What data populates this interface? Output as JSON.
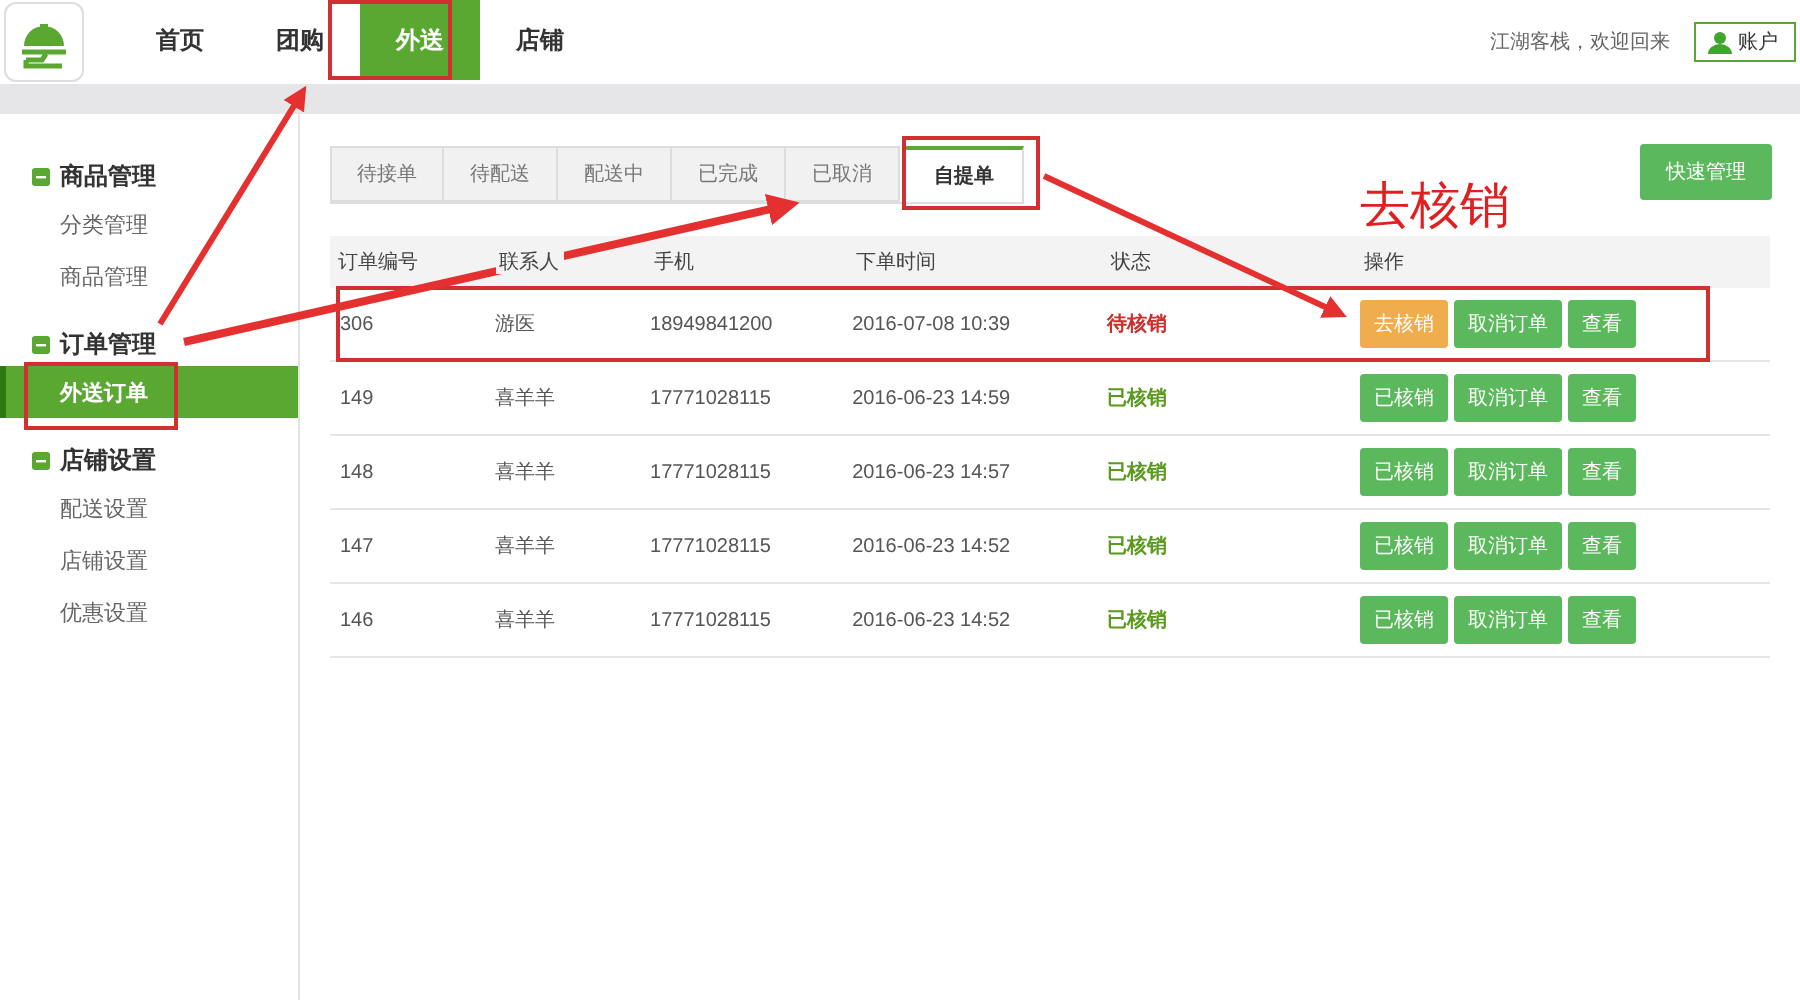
{
  "top_nav": [
    {
      "label": "首页",
      "selected": false
    },
    {
      "label": "团购",
      "selected": false
    },
    {
      "label": "外送",
      "selected": true
    },
    {
      "label": "店铺",
      "selected": false
    }
  ],
  "user": {
    "greeting": "江湖客栈，欢迎回来",
    "account": "账户"
  },
  "sidebar": [
    {
      "title": "商品管理",
      "expanded": true,
      "items": [
        {
          "label": "分类管理",
          "selected": false
        },
        {
          "label": "商品管理",
          "selected": false
        }
      ]
    },
    {
      "title": "订单管理",
      "expanded": true,
      "items": [
        {
          "label": "外送订单",
          "selected": true
        }
      ]
    },
    {
      "title": "店铺设置",
      "expanded": true,
      "items": [
        {
          "label": "配送设置",
          "selected": false
        },
        {
          "label": "店铺设置",
          "selected": false
        },
        {
          "label": "优惠设置",
          "selected": false
        }
      ]
    }
  ],
  "tabs": [
    {
      "label": "待接单",
      "selected": false
    },
    {
      "label": "待配送",
      "selected": false
    },
    {
      "label": "配送中",
      "selected": false
    },
    {
      "label": "已完成",
      "selected": false
    },
    {
      "label": "已取消",
      "selected": false
    },
    {
      "label": "自提单",
      "selected": true
    }
  ],
  "quick_button": "快速管理",
  "annotation": "去核销",
  "table": {
    "columns": [
      "订单编号",
      "联系人",
      "手机",
      "下单时间",
      "状态",
      "操作"
    ],
    "rows": [
      {
        "id": "306",
        "contact": "游医",
        "phone": "18949841200",
        "time": "2016-07-08 10:39",
        "status": {
          "text": "待核销",
          "kind": "pending"
        },
        "actions": [
          {
            "label": "去核销",
            "kind": "warn"
          },
          {
            "label": "取消订单",
            "kind": "ok"
          },
          {
            "label": "查看",
            "kind": "ok"
          }
        ]
      },
      {
        "id": "149",
        "contact": "喜羊羊",
        "phone": "17771028115",
        "time": "2016-06-23 14:59",
        "status": {
          "text": "已核销",
          "kind": "done"
        },
        "actions": [
          {
            "label": "已核销",
            "kind": "ok"
          },
          {
            "label": "取消订单",
            "kind": "ok"
          },
          {
            "label": "查看",
            "kind": "ok"
          }
        ]
      },
      {
        "id": "148",
        "contact": "喜羊羊",
        "phone": "17771028115",
        "time": "2016-06-23 14:57",
        "status": {
          "text": "已核销",
          "kind": "done"
        },
        "actions": [
          {
            "label": "已核销",
            "kind": "ok"
          },
          {
            "label": "取消订单",
            "kind": "ok"
          },
          {
            "label": "查看",
            "kind": "ok"
          }
        ]
      },
      {
        "id": "147",
        "contact": "喜羊羊",
        "phone": "17771028115",
        "time": "2016-06-23 14:52",
        "status": {
          "text": "已核销",
          "kind": "done"
        },
        "actions": [
          {
            "label": "已核销",
            "kind": "ok"
          },
          {
            "label": "取消订单",
            "kind": "ok"
          },
          {
            "label": "查看",
            "kind": "ok"
          }
        ]
      },
      {
        "id": "146",
        "contact": "喜羊羊",
        "phone": "17771028115",
        "time": "2016-06-23 14:52",
        "status": {
          "text": "已核销",
          "kind": "done"
        },
        "actions": [
          {
            "label": "已核销",
            "kind": "ok"
          },
          {
            "label": "取消订单",
            "kind": "ok"
          },
          {
            "label": "查看",
            "kind": "ok"
          }
        ]
      }
    ]
  }
}
